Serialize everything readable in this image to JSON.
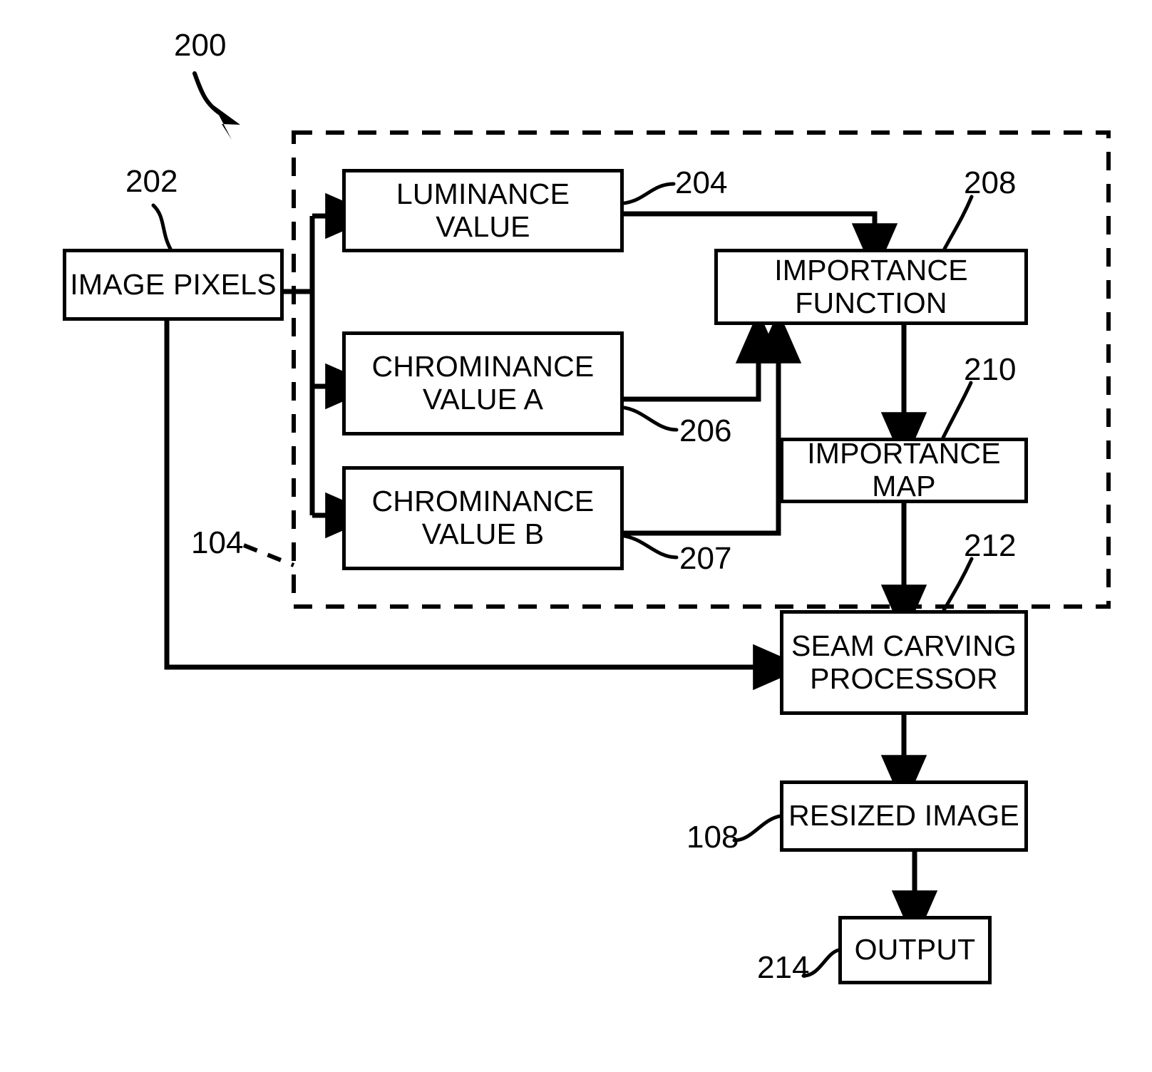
{
  "figure": {
    "id": "200",
    "type": "patent-block-diagram",
    "title": "Seam carving importance map block diagram"
  },
  "boxes": {
    "image_pixels": {
      "label": "IMAGE PIXELS",
      "ref": "202"
    },
    "luminance_value": {
      "label": "LUMINANCE VALUE",
      "ref": "204"
    },
    "chrominance_a": {
      "label": "CHROMINANCE\nVALUE A",
      "ref": "206"
    },
    "chrominance_b": {
      "label": "CHROMINANCE\nVALUE B",
      "ref": "207"
    },
    "importance_function": {
      "label": "IMPORTANCE FUNCTION",
      "ref": "208"
    },
    "importance_map": {
      "label": "IMPORTANCE MAP",
      "ref": "210"
    },
    "seam_carving_processor": {
      "label": "SEAM CARVING\nPROCESSOR",
      "ref": "212"
    },
    "resized_image": {
      "label": "RESIZED IMAGE",
      "ref": "108"
    },
    "output": {
      "label": "OUTPUT",
      "ref": "214"
    }
  },
  "refs": {
    "figure_number": "200",
    "image_pixels": "202",
    "luminance_value": "204",
    "chrominance_a": "206",
    "chrominance_b": "207",
    "importance_function": "208",
    "importance_map": "210",
    "seam_carving_processor": "212",
    "dashed_group": "104",
    "resized_image": "108",
    "output": "214"
  },
  "dashed_group": {
    "ref": "104",
    "description": "Dashed boundary enclosing luminance, chrominance and importance function blocks"
  },
  "connections": [
    {
      "from": "image_pixels",
      "to": "luminance_value"
    },
    {
      "from": "image_pixels",
      "to": "chrominance_a"
    },
    {
      "from": "image_pixels",
      "to": "chrominance_b"
    },
    {
      "from": "image_pixels",
      "to": "seam_carving_processor"
    },
    {
      "from": "luminance_value",
      "to": "importance_function"
    },
    {
      "from": "chrominance_a",
      "to": "importance_function"
    },
    {
      "from": "chrominance_b",
      "to": "importance_function"
    },
    {
      "from": "importance_function",
      "to": "importance_map"
    },
    {
      "from": "importance_map",
      "to": "seam_carving_processor"
    },
    {
      "from": "seam_carving_processor",
      "to": "resized_image"
    },
    {
      "from": "resized_image",
      "to": "output"
    }
  ],
  "colors": {
    "line": "#000000",
    "background": "#ffffff"
  }
}
